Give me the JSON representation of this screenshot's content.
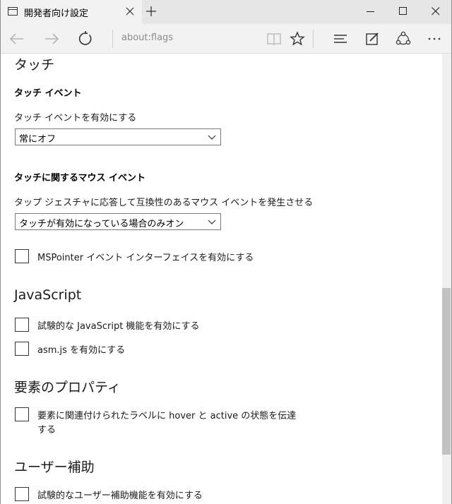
{
  "tab": {
    "title": "開発者向け設定",
    "icon": "page-icon"
  },
  "address": {
    "url": "about:flags"
  },
  "sections": {
    "touch": {
      "heading": "タッチ",
      "touch_events_heading": "タッチ イベント",
      "touch_events_label": "タッチ イベントを有効にする",
      "touch_events_value": "常にオフ",
      "mouse_events_heading": "タッチに関するマウス イベント",
      "mouse_events_label": "タップ ジェスチャに応答して互換性のあるマウス イベントを発生させる",
      "mouse_events_value": "タッチが有効になっている場合のみオン",
      "mspointer_label": "MSPointer イベント インターフェイスを有効にする",
      "mspointer_checked": false
    },
    "javascript": {
      "heading": "JavaScript",
      "experimental_label": "試験的な JavaScript 機能を有効にする",
      "experimental_checked": false,
      "asmjs_label": "asm.js を有効にする",
      "asmjs_checked": false
    },
    "element_properties": {
      "heading": "要素のプロパティ",
      "hover_active_label_line1": "要素に関連付けられたラベルに hover と active の状態を伝達",
      "hover_active_label_line2": "する",
      "hover_active_checked": false
    },
    "accessibility": {
      "heading": "ユーザー補助",
      "experimental_label": "試験的なユーザー補助機能を有効にする",
      "experimental_checked": false
    }
  },
  "colors": {
    "tabbar_bg": "#e6e6e6",
    "active_tab_bg": "#f2f2f2",
    "scroll_thumb": "#c2c2c2"
  }
}
